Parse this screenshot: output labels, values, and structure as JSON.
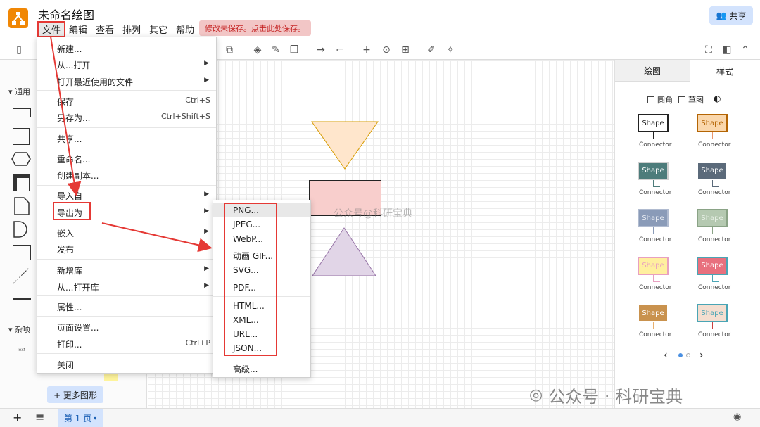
{
  "app": {
    "title": "未命名绘图",
    "share_label": "共享"
  },
  "menu": [
    "文件",
    "编辑",
    "查看",
    "排列",
    "其它",
    "帮助"
  ],
  "unsaved_notice": "修改未保存。点击此处保存。",
  "file_menu": [
    {
      "label": "新建..."
    },
    {
      "label": "从...打开",
      "arrow": "▶"
    },
    {
      "label": "打开最近使用的文件",
      "arrow": "▶"
    },
    {
      "label": "保存",
      "shortcut": "Ctrl+S"
    },
    {
      "label": "另存为...",
      "shortcut": "Ctrl+Shift+S"
    },
    {
      "label": "共享..."
    },
    {
      "label": "重命名..."
    },
    {
      "label": "创建副本..."
    },
    {
      "label": "导入自",
      "arrow": "▶"
    },
    {
      "label": "导出为",
      "arrow": "▶"
    },
    {
      "label": "嵌入",
      "arrow": "▶"
    },
    {
      "label": "发布"
    },
    {
      "label": "新增库",
      "arrow": "▶"
    },
    {
      "label": "从...打开库",
      "arrow": "▶"
    },
    {
      "label": "属性..."
    },
    {
      "label": "页面设置..."
    },
    {
      "label": "打印...",
      "shortcut": "Ctrl+P"
    },
    {
      "label": "关闭"
    }
  ],
  "export_menu": [
    "PNG...",
    "JPEG...",
    "WebP...",
    "动画 GIF...",
    "SVG...",
    "PDF...",
    "HTML...",
    "XML...",
    "URL...",
    "JSON...",
    "高级..."
  ],
  "left_panel": {
    "section_general": "通用",
    "section_misc": "杂项",
    "more_shapes": "+ 更多图形",
    "text_sample": "Text"
  },
  "right_panel": {
    "tabs": [
      "绘图",
      "样式"
    ],
    "rounded_label": "圆角",
    "sketch_label": "草图",
    "shape_label": "Shape",
    "connector_label": "Connector",
    "pager": {
      "prev": "‹",
      "next": "›"
    }
  },
  "footer": {
    "page_label": "第 1 页",
    "add": "+",
    "menu": "≡"
  },
  "watermark": "公众号 · 科研宝典",
  "canvas_watermark": "公众号@科研宝典",
  "colors": {
    "accent": "#f08705",
    "red": "#e53935",
    "share_bg": "#d3e3fd"
  }
}
